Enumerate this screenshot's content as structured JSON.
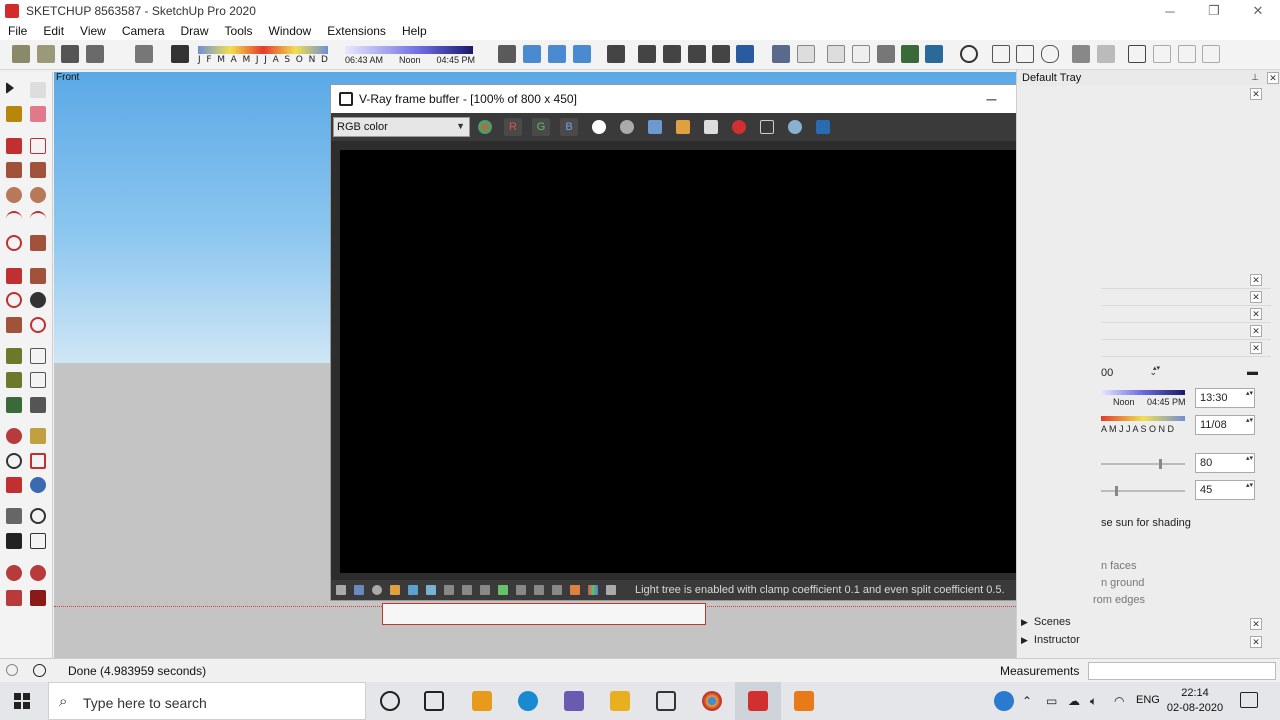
{
  "app": {
    "title": "SKETCHUP 8563587 - SketchUp Pro 2020",
    "window_controls": [
      "─",
      "❐",
      "✕"
    ]
  },
  "menu": [
    "File",
    "Edit",
    "View",
    "Camera",
    "Draw",
    "Tools",
    "Window",
    "Extensions",
    "Help"
  ],
  "toolbar": {
    "months": [
      "J",
      "F",
      "M",
      "A",
      "M",
      "J",
      "J",
      "A",
      "S",
      "O",
      "N",
      "D"
    ],
    "time_start": "06:43 AM",
    "time_noon": "Noon",
    "time_end": "04:45 PM"
  },
  "viewport": {
    "scene_label": "Front"
  },
  "vfb": {
    "title": "V-Ray frame buffer - [100% of 800 x 450]",
    "controls": [
      "─",
      "☐",
      "✕"
    ],
    "channel": "RGB color",
    "channel_buttons": [
      "R",
      "G",
      "B"
    ],
    "status_message": "Light tree is enabled with clamp coefficient 0.1 and even split coefficient 0.5."
  },
  "tray": {
    "title": "Default Tray",
    "time_value_partial": "00",
    "noon_label": "Noon",
    "end_time": "04:45 PM",
    "months_partial": "A M J J A S O N D",
    "time": "13:30",
    "date": "11/08",
    "light": "80",
    "dark": "45",
    "use_sun": "se sun for shading",
    "on_faces": "n faces",
    "on_ground": "n ground",
    "from_edges": "rom edges",
    "sections": [
      "Scenes",
      "Instructor"
    ]
  },
  "status": {
    "message": "Done (4.983959 seconds)",
    "measurements_label": "Measurements"
  },
  "taskbar": {
    "search_placeholder": "Type here to search",
    "language": "ENG",
    "time": "22:14",
    "date": "02-08-2020"
  }
}
